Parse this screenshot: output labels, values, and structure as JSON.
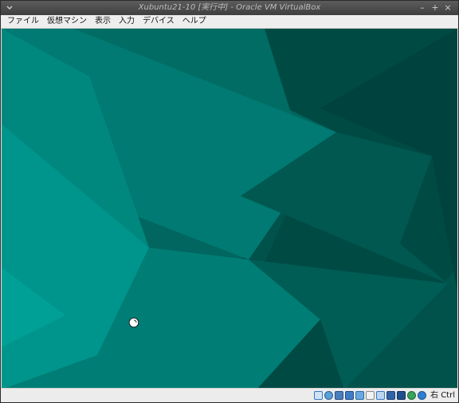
{
  "window": {
    "title": "Xubuntu21-10 [実行中] - Oracle VM VirtualBox",
    "menu_icon": "chevron-down-icon",
    "minimize_glyph": "–",
    "maximize_glyph": "+",
    "close_glyph": "×"
  },
  "menubar": {
    "items": [
      "ファイル",
      "仮想マシン",
      "表示",
      "入力",
      "デバイス",
      "ヘルプ"
    ]
  },
  "vm_display": {
    "wallpaper": "teal-polygon-wallpaper",
    "colors": {
      "dark": "#00453f",
      "mid": "#006d65",
      "light": "#00928a",
      "accent": "#00a39a"
    }
  },
  "statusbar": {
    "icons": [
      "hard-disk-icon",
      "optical-drive-icon",
      "audio-icon",
      "network-icon",
      "usb-icon",
      "shared-folders-icon",
      "display-icon",
      "recording-icon",
      "cpu-icon",
      "mouse-integration-icon",
      "keyboard-icon"
    ],
    "host_key": "右 Ctrl"
  }
}
